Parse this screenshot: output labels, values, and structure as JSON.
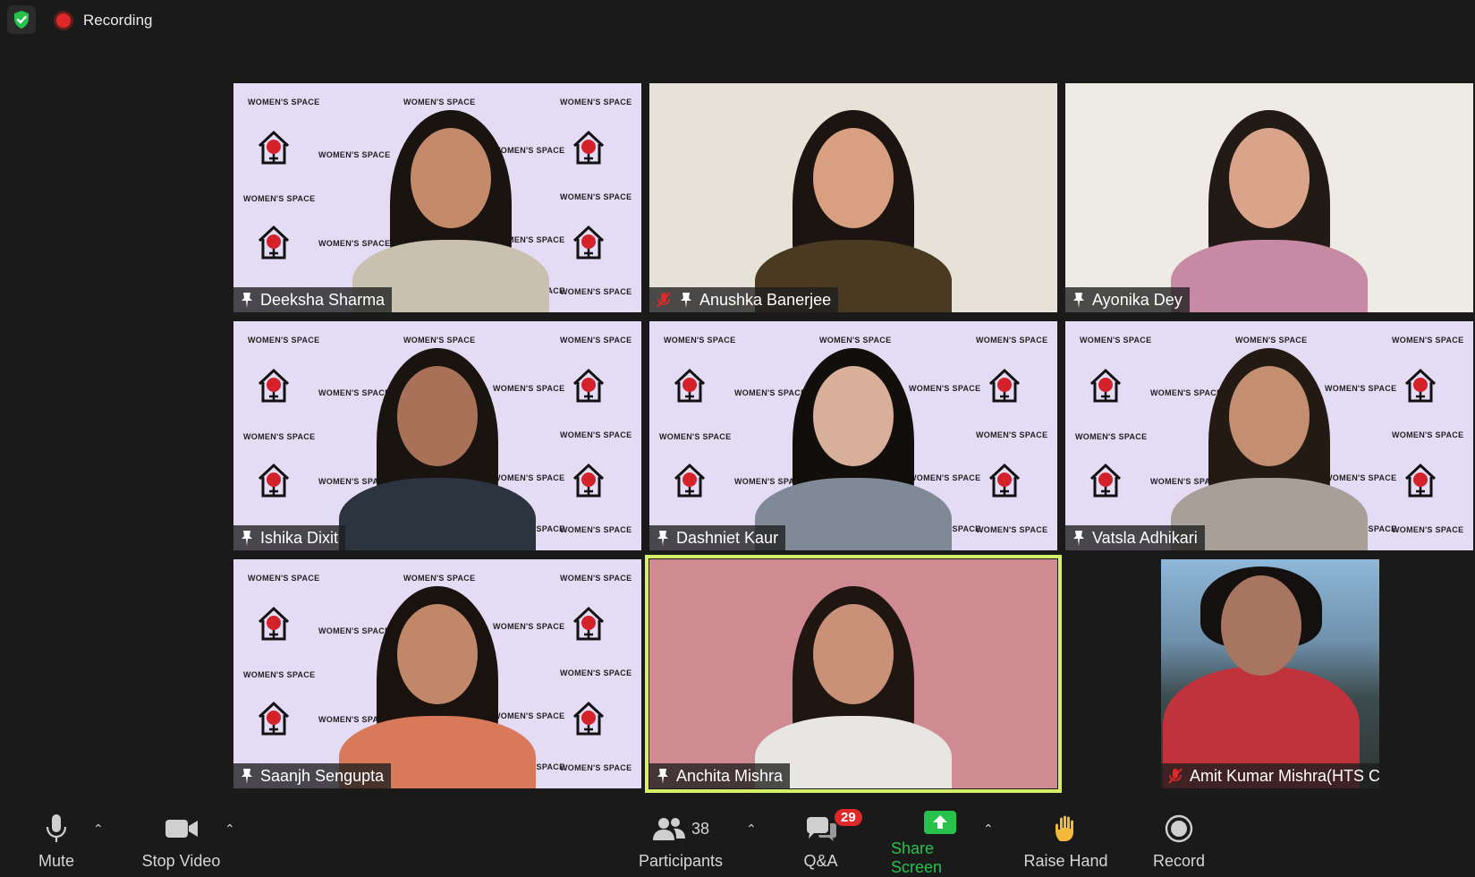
{
  "topbar": {
    "shield_icon": "shield-check-icon",
    "recording_label": "Recording"
  },
  "backdrop_text": "WOMEN'S SPACE",
  "participants_grid": [
    {
      "name": "Deeksha Sharma",
      "muted": false,
      "background": "womens-space"
    },
    {
      "name": "Anushka Banerjee",
      "muted": true,
      "background": "room"
    },
    {
      "name": "Ayonika Dey",
      "muted": false,
      "background": "room"
    },
    {
      "name": "Ishika Dixit",
      "muted": false,
      "background": "womens-space"
    },
    {
      "name": "Dashniet Kaur",
      "muted": false,
      "background": "womens-space"
    },
    {
      "name": "Vatsla Adhikari",
      "muted": false,
      "background": "womens-space"
    },
    {
      "name": "Saanjh Sengupta",
      "muted": false,
      "background": "womens-space"
    },
    {
      "name": "Anchita Mishra",
      "muted": false,
      "background": "room",
      "active_speaker": true
    },
    {
      "name": "Amit Kumar Mishra(HTS Co-fou...",
      "muted": true,
      "background": "store"
    }
  ],
  "toolbar": {
    "mute_label": "Mute",
    "stop_video_label": "Stop Video",
    "participants_label": "Participants",
    "participants_count": "38",
    "qa_label": "Q&A",
    "qa_badge": "29",
    "share_screen_label": "Share Screen",
    "raise_hand_label": "Raise Hand",
    "record_label": "Record"
  },
  "colors": {
    "background": "#1a1a1a",
    "active_speaker_border": "#d7f06a",
    "share_green": "#27c24c",
    "badge_red": "#e02828",
    "backdrop_lavender": "#e4dcf5"
  }
}
